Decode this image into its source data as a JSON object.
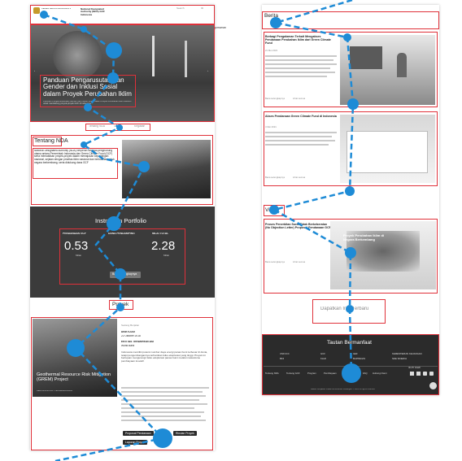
{
  "header": {
    "logo_text": "KEMENTERIAN KEUANGAN REPUBLIK INDONESIA",
    "nda_title": "National Designated Authority (NDA) GCF Indonesia",
    "search_label": "Search",
    "lang": "ID",
    "nav": [
      "Tentang NDA",
      "Tentang GCF",
      "Program",
      "Pembiayaan",
      "Pengumuman"
    ]
  },
  "hero": {
    "title": "Panduan Pengarusutamaan Gender dan Inklusi Sosial dalam Proyek Perubahan Iklim",
    "desc": "Panduan Pengarusutamaan Gender dan Inklusi Sosial dalam Proyek Perubahan Iklim disusun untuk mendukung proyek-proyek GCF di Indonesia.",
    "prev_arrow": "‹",
    "next_arrow": "›"
  },
  "sub_tabs": [
    "Tentang NDA",
    "GCF",
    "Kegiatan"
  ],
  "about": {
    "heading": "Tentang NDA",
    "body": "National Designated Authority (NDA) berperan sebagai penghubung utama antara Pemerintah Indonesia dan Green Climate Fund (GCF) serta memastikan proyek-proyek dalam memajukan kepentingan nasional, sejalan dengan prioritas iklim nasional dan berkualitas untuk negara berkembang, serta didukung dana GCF"
  },
  "portfolio": {
    "title": "Instrumen Portfolio",
    "stats": [
      {
        "label": "PENDANAAN GCF",
        "value": "0.53",
        "unit": "Miliar"
      },
      {
        "label": "DANA PENDAMPING",
        "value": "",
        "unit": ""
      },
      {
        "label": "NILAI TOTAL",
        "value": "2.28",
        "unit": "Miliar"
      }
    ],
    "button": "Baca Selengkapnya"
  },
  "project": {
    "heading": "Proyek",
    "card_title": "Geothermal Resource Risk Mitigation (GREM) Project",
    "card_sub": "BERLANGSUNG / PENGEMBANGAN",
    "meta": [
      "DISETUJUI",
      "22 Oktober 2018",
      "ENTITAS TERAKREDITASI",
      "World Bank"
    ],
    "body": "Indonesia memiliki potensi sumber daya energi panas bumi terbesar di dunia, tetapi pengembangannya terhambat risiko eksplorasi yang tinggi. Proyek ini bertujuan mengurangi risiko eksplorasi panas bumi melalui mekanisme pembiayaan inovatif.",
    "btn_primary": "Proposal Pendanaan",
    "btn_secondary": "Rincian Proyek",
    "btn_third": "Laporan Proyek",
    "card_badge": "Sedang Berjalan"
  },
  "news": {
    "heading": "Berita",
    "items": [
      {
        "title": "Berbagi Pengalaman Terkait Mengakses Pendanaan Perubahan Iklim dari Green Climate Fund",
        "date": "21 Mei 2021",
        "more": "Baca selengkapnya",
        "share": "Lihat semua"
      },
      {
        "title": "Akses Pendanaan Green Climate Fund di Indonesia",
        "date": "4 Mei 2021",
        "more": "Baca selengkapnya",
        "share": "Lihat semua"
      }
    ]
  },
  "video": {
    "heading": "Video",
    "title": "Proses Penerbitan Surat Tidak Berkeberatan (No Objection Letter) Proposal Pendanaan GCF",
    "overlay": "Proyek Perubahan Iklim di Negara Berkembang",
    "more": "Baca selengkapnya",
    "share": "Lihat semua"
  },
  "links_section": {
    "heading": "Dapatkan Info Terbaru"
  },
  "footer": {
    "heading": "Tautan Bermanfaat",
    "links": [
      "UNFCCC",
      "GCF",
      "GEF",
      "KEMENTERIAN KEUANGAN",
      "BKF",
      "KLHK",
      "BAPPENAS",
      "NDE SINERGI"
    ],
    "nav": [
      "Tentang NDA",
      "Tentang GCF",
      "Program",
      "Pembiayaan",
      "Kegiatan",
      "FAQ",
      "Hubungi Kami"
    ],
    "social_label": "IKUTI KAMI",
    "copyright": "Badan Kebijakan Fiskal Kementerian Keuangan © 2021 All rights reserved"
  },
  "colors": {
    "accent": "#e0313a",
    "dot": "#1e8bd6",
    "footer_bg": "#2b2b2b",
    "nav_gray": "#444444"
  }
}
